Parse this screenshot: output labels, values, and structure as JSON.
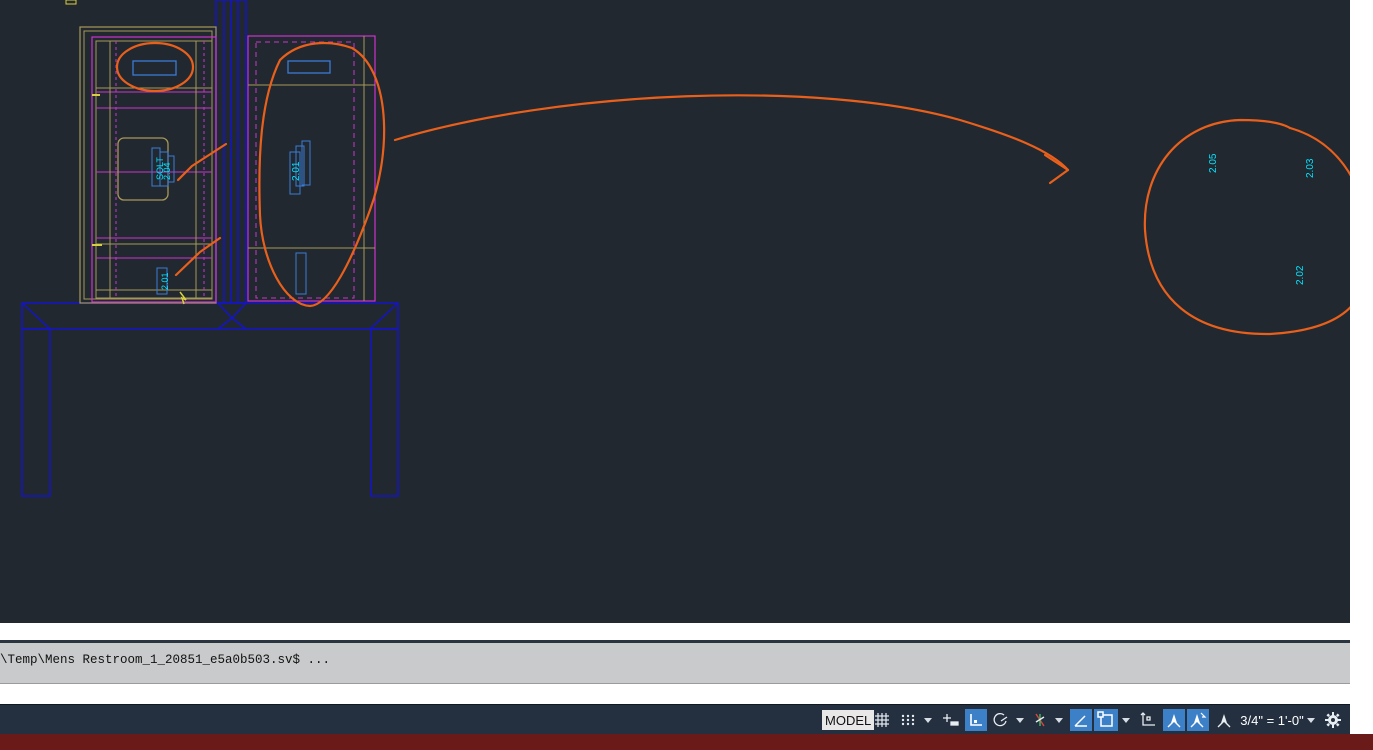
{
  "drawing": {
    "room_tags": [
      "2.01",
      "2.05",
      "2.03",
      "2.02"
    ],
    "colors": {
      "background": "#212830",
      "outline_blue": "#1414c8",
      "magenta": "#cc33cc",
      "olive": "#a89858",
      "cyan_text": "#00e5ff",
      "markup_orange": "#e8601c"
    }
  },
  "command_line": {
    "history_text": "\\Temp\\Mens Restroom_1_20851_e5a0b503.sv$ ...",
    "input_value": "",
    "input_placeholder": ""
  },
  "status_bar": {
    "model_label": "MODEL",
    "annotation_scale": "3/4\" = 1'-0\"",
    "icons": [
      "grid-icon",
      "snap-icon",
      "infer-icon",
      "ortho-icon",
      "polar-icon",
      "isometric-icon",
      "osnap-track-icon",
      "osnap-icon",
      "ucs-icon",
      "annotation-visibility-icon",
      "auto-scale-icon",
      "annotation-scale-icon",
      "settings-gear-icon"
    ]
  }
}
